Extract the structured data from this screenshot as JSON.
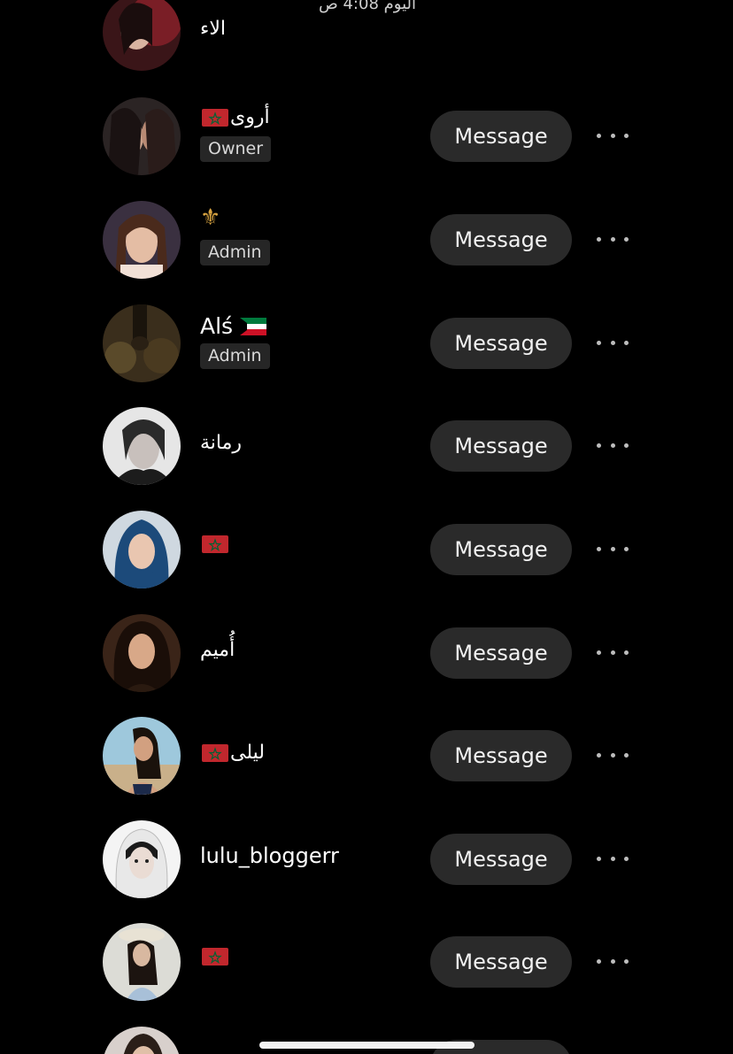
{
  "status_bar": {
    "time": "اليوم 4:08 ص"
  },
  "members": [
    {
      "name": "الاء",
      "flag": "",
      "role": "",
      "has_message": false
    },
    {
      "name": "أروى",
      "flag": "morocco",
      "role": "Owner",
      "has_message": true
    },
    {
      "name": "",
      "flag": "fleur-de-lis",
      "role": "Admin",
      "has_message": true
    },
    {
      "name": "Alś",
      "flag": "kuwait",
      "role": "Admin",
      "has_message": true
    },
    {
      "name": "رمانة",
      "flag": "",
      "role": "",
      "has_message": true
    },
    {
      "name": "",
      "flag": "morocco",
      "role": "",
      "has_message": true
    },
    {
      "name": "أُميم",
      "flag": "",
      "role": "",
      "has_message": true
    },
    {
      "name": "ليلى",
      "flag": "morocco",
      "role": "",
      "has_message": true
    },
    {
      "name": "lulu_bloggerr",
      "flag": "",
      "role": "",
      "has_message": true
    },
    {
      "name": "",
      "flag": "morocco",
      "role": "",
      "has_message": true
    }
  ],
  "labels": {
    "message_button": "Message"
  },
  "icons": {
    "more": "more-horizontal-icon",
    "lily": "⚜"
  },
  "colors": {
    "background": "#000000",
    "button_bg": "#2a2a2a",
    "badge_bg": "#262626",
    "morocco_red": "#c1272d",
    "morocco_green": "#006233"
  }
}
